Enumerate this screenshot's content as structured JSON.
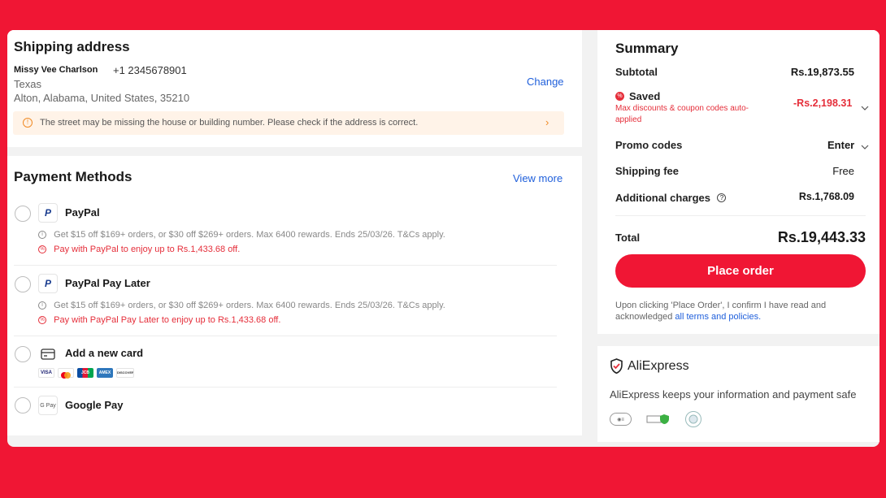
{
  "shipping": {
    "title": "Shipping address",
    "name": "Missy Vee Charlson",
    "phone": "+1 2345678901",
    "state": "Texas",
    "address": "Alton, Alabama, United States, 35210",
    "change_label": "Change",
    "warning": "The street may be missing the house or building number. Please check if the address is correct."
  },
  "payment": {
    "title": "Payment Methods",
    "view_more": "View more",
    "methods": [
      {
        "label": "PayPal",
        "icon": "paypal-icon",
        "info": "Get $15 off $169+ orders, or $30 off $269+ orders. Max 6400 rewards. Ends 25/03/26. T&Cs apply.",
        "promo": "Pay with PayPal to enjoy up to Rs.1,433.68 off."
      },
      {
        "label": "PayPal Pay Later",
        "icon": "paypal-icon",
        "info": "Get $15 off $169+ orders, or $30 off $269+ orders. Max 6400 rewards. Ends 25/03/26. T&Cs apply.",
        "promo": "Pay with PayPal Pay Later to enjoy up to Rs.1,433.68 off."
      },
      {
        "label": "Add a new card",
        "icon": "credit-card-icon",
        "brands": [
          "VISA",
          "Mastercard",
          "JCB",
          "AMEX",
          "DISCOVER"
        ]
      },
      {
        "label": "Google Pay",
        "icon": "google-pay-icon",
        "icon_text": "G Pay"
      }
    ]
  },
  "summary": {
    "title": "Summary",
    "subtotal_label": "Subtotal",
    "subtotal_value": "Rs.19,873.55",
    "saved_label": "Saved",
    "saved_note": "Max discounts & coupon codes auto-applied",
    "saved_value": "-Rs.2,198.31",
    "promo_label": "Promo codes",
    "promo_action": "Enter",
    "shipping_label": "Shipping fee",
    "shipping_value": "Free",
    "additional_label": "Additional charges",
    "additional_value": "Rs.1,768.09",
    "total_label": "Total",
    "total_value": "Rs.19,443.33",
    "place_order": "Place order",
    "terms_text": "Upon clicking 'Place Order', I confirm I have read and acknowledged",
    "terms_link": "all terms and policies."
  },
  "trust": {
    "brand": "AliExpress",
    "tagline": "AliExpress keeps your information and payment safe"
  },
  "colors": {
    "accent": "#F01634",
    "link": "#1F5FDB",
    "discount": "#E52E3A"
  }
}
